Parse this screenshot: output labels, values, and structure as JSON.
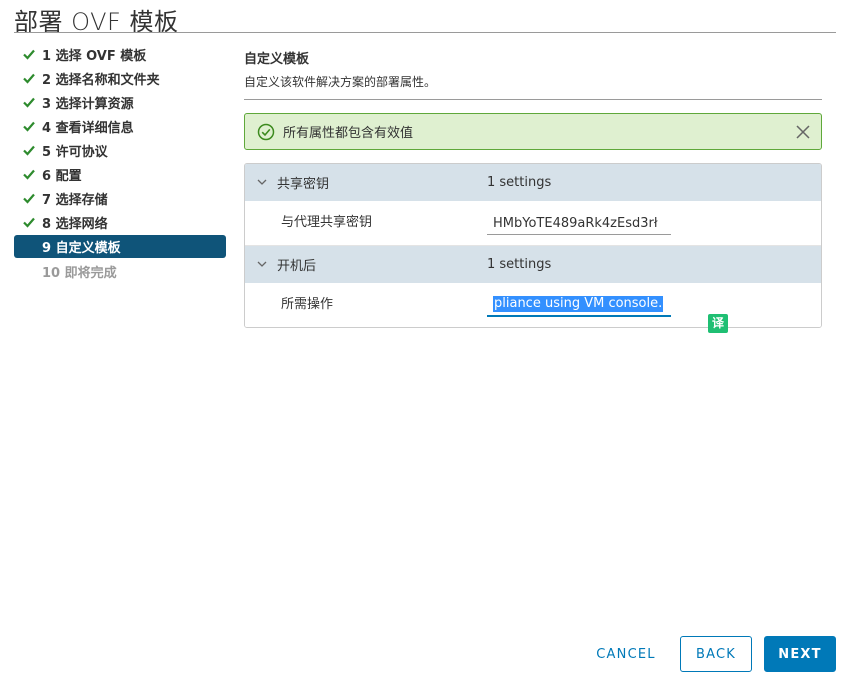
{
  "window": {
    "title": "部署 OVF 模板"
  },
  "steps": [
    {
      "label": "1 选择 OVF 模板",
      "state": "done"
    },
    {
      "label": "2 选择名称和文件夹",
      "state": "done"
    },
    {
      "label": "3 选择计算资源",
      "state": "done"
    },
    {
      "label": "4 查看详细信息",
      "state": "done"
    },
    {
      "label": "5 许可协议",
      "state": "done"
    },
    {
      "label": "6 配置",
      "state": "done"
    },
    {
      "label": "7 选择存储",
      "state": "done"
    },
    {
      "label": "8 选择网络",
      "state": "done"
    },
    {
      "label": "9 自定义模板",
      "state": "active"
    },
    {
      "label": "10 即将完成",
      "state": "disabled"
    }
  ],
  "main": {
    "title": "自定义模板",
    "description": "自定义该软件解决方案的部署属性。"
  },
  "alert": {
    "text": "所有属性都包含有效值",
    "icon": "check-circle-icon"
  },
  "groups": [
    {
      "name": "共享密钥",
      "count": "1 settings",
      "rows": [
        {
          "label": "与代理共享密钥",
          "value": "HMbYoTE489aRk4zEsd3rł"
        }
      ]
    },
    {
      "name": "开机后",
      "count": "1 settings",
      "rows": [
        {
          "label": "所需操作",
          "value": "pliance using VM console."
        }
      ]
    }
  ],
  "translate_badge": "译",
  "buttons": {
    "cancel": "CANCEL",
    "back": "BACK",
    "next": "NEXT"
  },
  "colors": {
    "accent": "#0079b8",
    "active_step": "#0f5479",
    "success_bg": "#dff0d0",
    "success_border": "#5fa83a",
    "check_green": "#2e8b2e",
    "group_header_bg": "#d6e1e9"
  }
}
